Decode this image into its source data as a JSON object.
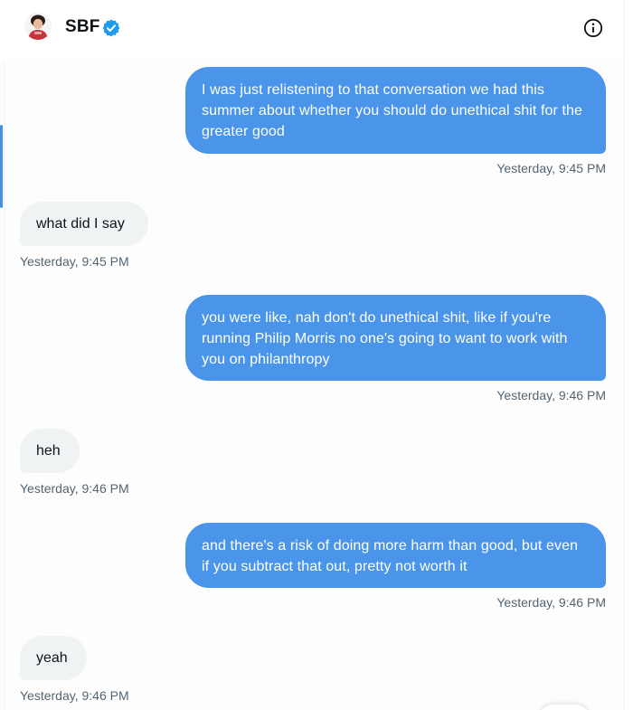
{
  "header": {
    "name": "SBF",
    "avatar_icon": "profile-avatar",
    "verified_icon": "verified-badge-icon",
    "info_icon": "info-icon"
  },
  "messages": [
    {
      "direction": "out",
      "text": "I was just relistening to that conversation we had this summer about whether you should do unethical shit for the greater good",
      "time": "Yesterday, 9:45 PM"
    },
    {
      "direction": "in",
      "text": "what did I say",
      "time": "Yesterday, 9:45 PM"
    },
    {
      "direction": "out",
      "text": "you were like, nah don't do unethical shit, like if you're running Philip Morris no one's going to want to work with you on philanthropy",
      "time": "Yesterday, 9:46 PM"
    },
    {
      "direction": "in",
      "text": "heh",
      "time": "Yesterday, 9:46 PM"
    },
    {
      "direction": "out",
      "text": "and there's a risk of doing more harm than good, but even if you subtract that out, pretty not worth it",
      "time": "Yesterday, 9:46 PM"
    },
    {
      "direction": "in",
      "text": "yeah",
      "time": "Yesterday, 9:46 PM"
    }
  ],
  "colors": {
    "outgoing_bubble": "#4a95e9",
    "incoming_bubble": "#eff3f4",
    "timestamp": "#536471",
    "verified": "#1d9bf0"
  }
}
